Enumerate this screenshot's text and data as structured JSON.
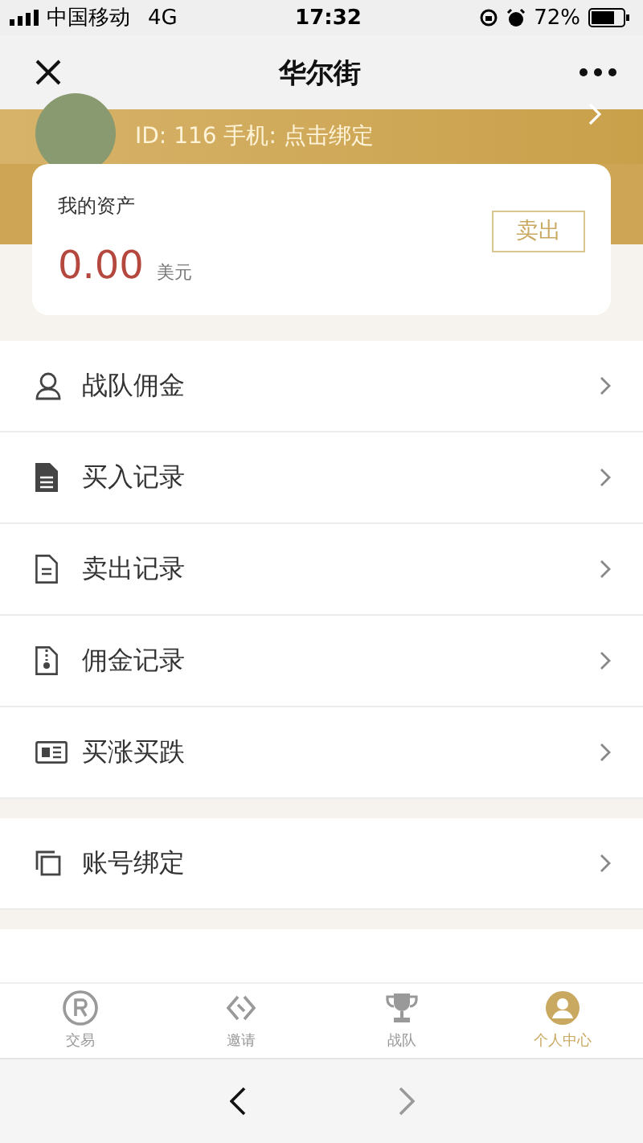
{
  "status_bar": {
    "carrier": "中国移动",
    "network": "4G",
    "time": "17:32",
    "battery": "72%"
  },
  "nav": {
    "title": "华尔街"
  },
  "profile": {
    "id_line": "ID: 116 手机: 点击绑定"
  },
  "assets": {
    "label": "我的资产",
    "amount": "0.00",
    "unit": "美元",
    "sell_button": "卖出"
  },
  "menu_groups": [
    [
      {
        "kind": "person",
        "label": "战队佣金"
      },
      {
        "kind": "doc-filled",
        "label": "买入记录"
      },
      {
        "kind": "doc",
        "label": "卖出记录"
      },
      {
        "kind": "zip",
        "label": "佣金记录"
      },
      {
        "kind": "news",
        "label": "买涨买跌"
      }
    ],
    [
      {
        "kind": "copy",
        "label": "账号绑定"
      }
    ]
  ],
  "tabs": [
    {
      "kind": "registered",
      "label": "交易",
      "selected": false
    },
    {
      "kind": "link",
      "label": "邀请",
      "selected": false
    },
    {
      "kind": "trophy",
      "label": "战队",
      "selected": false
    },
    {
      "kind": "user",
      "label": "个人中心",
      "selected": true
    }
  ]
}
